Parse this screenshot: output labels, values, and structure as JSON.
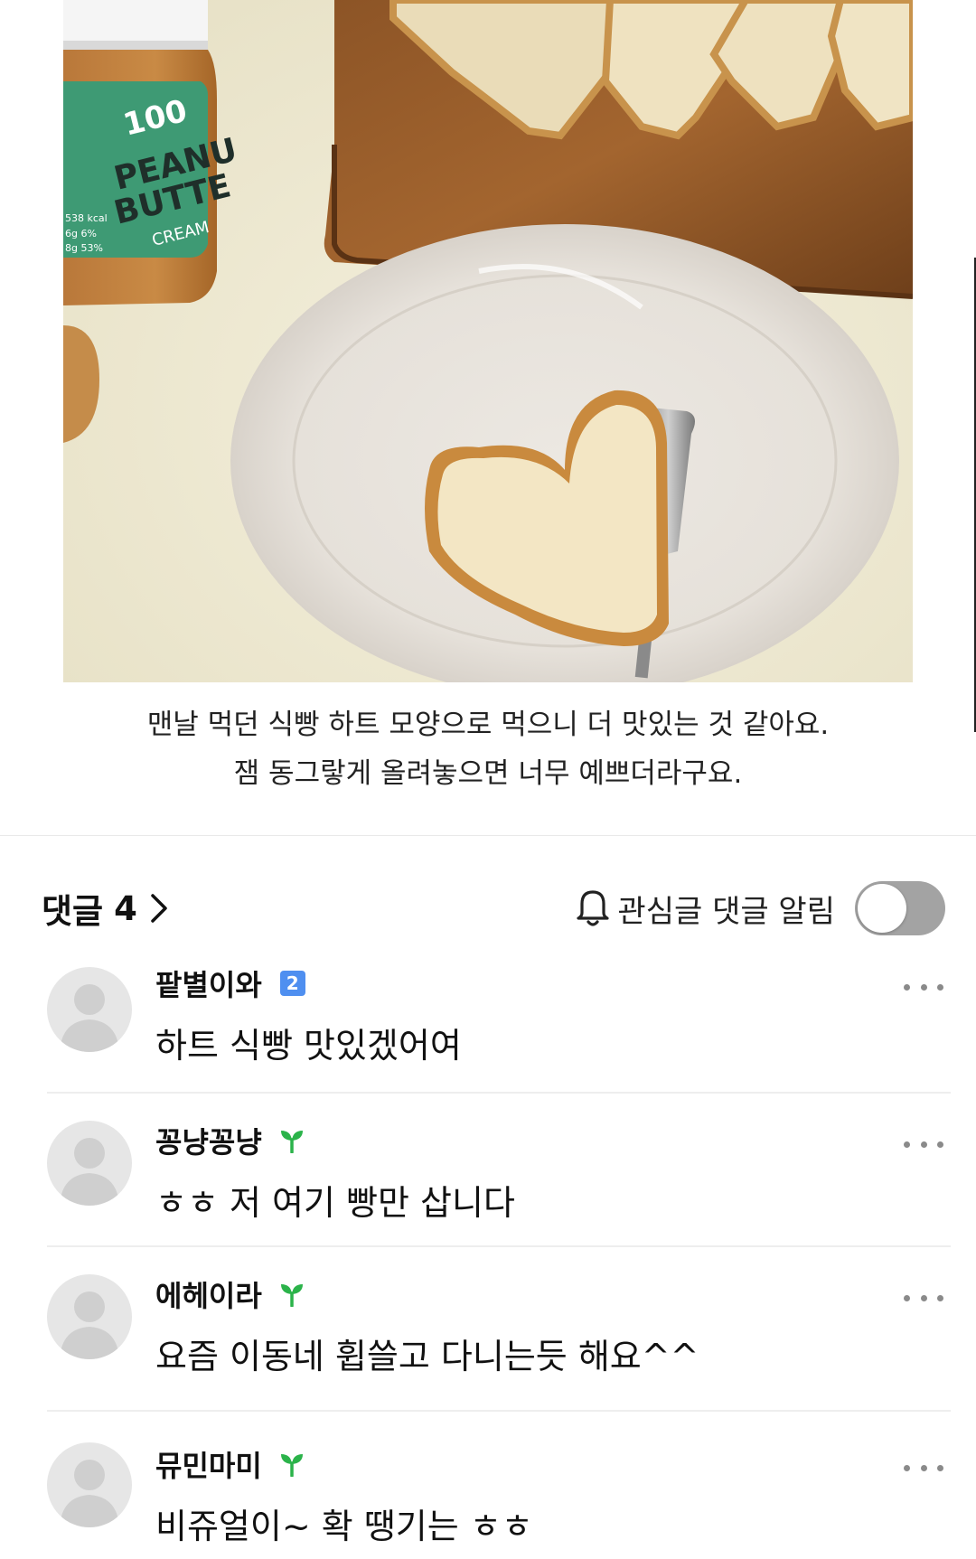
{
  "post": {
    "image_alt": "peanut-butter-jar, bread-slices-on-cutting-board, heart-shaped-toast-on-plate",
    "caption_lines": [
      "맨날 먹던 식빵 하트 모양으로 먹으니 더 맛있는 것 같아요.",
      "잼 동그랗게 올려놓으면 너무 예쁘더라구요."
    ],
    "jar_label": {
      "top": "100",
      "line1": "PEANU",
      "line2": "BUTTE",
      "line3": "CREAM",
      "kcal": "538 kcal",
      "row1": "6g 6%",
      "row2": "8g 53%"
    }
  },
  "comments_header": {
    "label": "댓글",
    "count": "4",
    "chevron_icon": "chevron-right-icon",
    "bell_icon": "bell-icon",
    "notify_label": "관심글 댓글 알림",
    "notify_enabled": false
  },
  "comments": [
    {
      "author": "팥별이와",
      "badge_type": "level",
      "badge_text": "2",
      "text": "하트 식빵 맛있겠어여"
    },
    {
      "author": "꽁냥꽁냥",
      "badge_type": "sprout",
      "badge_text": "",
      "text": "ㅎㅎ 저 여기 빵만 삽니다"
    },
    {
      "author": "에헤이라",
      "badge_type": "sprout",
      "badge_text": "",
      "text": "요즘 이동네 휩쓸고 다니는듯 해요^^"
    },
    {
      "author": "뮤민마미",
      "badge_type": "sprout",
      "badge_text": "",
      "text": "비쥬얼이~ 확 땡기는 ㅎㅎ"
    }
  ],
  "colors": {
    "toggle_off": "#a3a3a3",
    "level_badge": "#4f8ff0",
    "sprout": "#2bb34a",
    "divider": "#eeeeee",
    "more_dots": "#8a8a8a"
  }
}
